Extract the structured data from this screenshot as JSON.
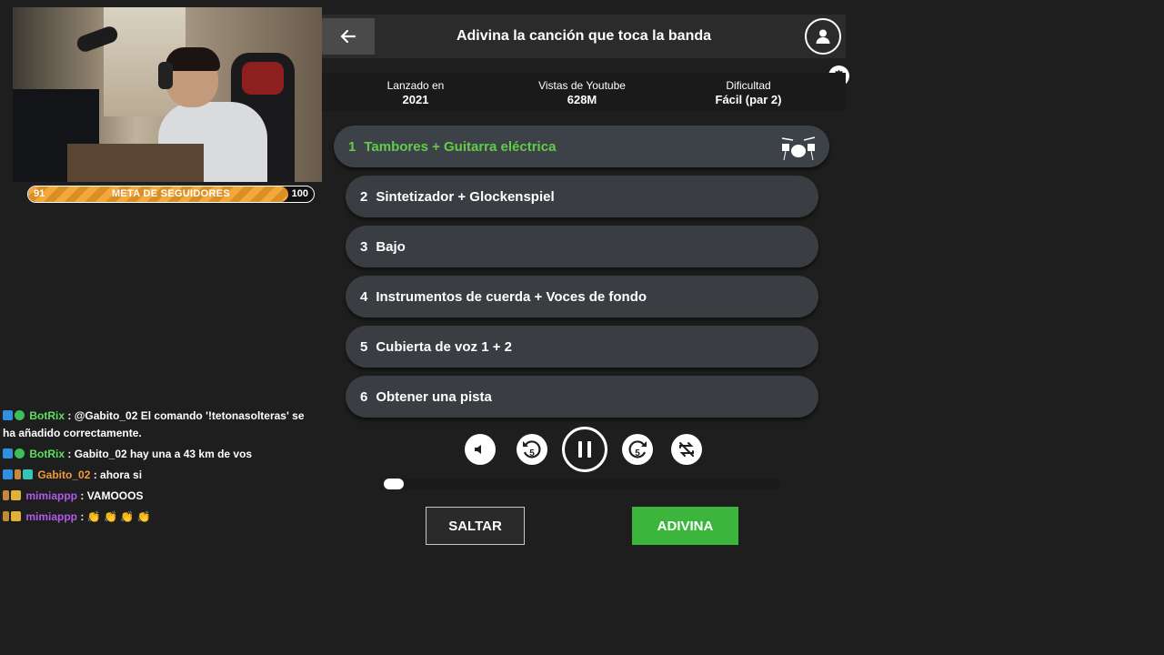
{
  "stream": {
    "goal": {
      "start": "91",
      "label": "META DE SEGUIDORES",
      "end": "100",
      "fraction": 0.91
    }
  },
  "chat": [
    {
      "user": "BotRix",
      "sep": " : ",
      "text": "@Gabito_02 El comando '!tetonasolteras' se ha añadido correctamente.",
      "user_color": "#5ee05e"
    },
    {
      "user": "BotRix",
      "sep": " : ",
      "text": "Gabito_02 hay una a 43 km de vos",
      "user_color": "#5ee05e"
    },
    {
      "user": "Gabito_02",
      "sep": " : ",
      "text": "ahora si",
      "user_color": "#f39a3c"
    },
    {
      "user": "mimiappp",
      "sep": " : ",
      "text": "VAMOOOS",
      "user_color": "#b15ae8"
    },
    {
      "user": "mimiappp",
      "sep": " : ",
      "text": "👏 👏 👏 👏",
      "user_color": "#b15ae8"
    }
  ],
  "game": {
    "title": "Adivina la canción que toca la banda",
    "back_icon": "arrow-left-icon",
    "profile_icon": "user-icon",
    "settings_icon": "gear-icon",
    "stats": [
      {
        "label": "Lanzado en",
        "value": "2021"
      },
      {
        "label": "Vistas de Youtube",
        "value": "628M"
      },
      {
        "label": "Dificultad",
        "value": "Fácil (par 2)"
      }
    ],
    "tracks": [
      {
        "num": "1",
        "label": "Tambores + Guitarra eléctrica",
        "active": true
      },
      {
        "num": "2",
        "label": "Sintetizador + Glockenspiel"
      },
      {
        "num": "3",
        "label": "Bajo"
      },
      {
        "num": "4",
        "label": "Instrumentos de cuerda + Voces de fondo"
      },
      {
        "num": "5",
        "label": "Cubierta de voz 1 + 2"
      },
      {
        "num": "6",
        "label": "Obtener una pista"
      }
    ],
    "controls": {
      "rewind_label": "5",
      "forward_label": "5",
      "progress_fraction": 0.05
    },
    "buttons": {
      "skip": "SALTAR",
      "guess": "ADIVINA"
    },
    "colors": {
      "accent_green": "#3bb53b",
      "active_track_text": "#62cc4a"
    }
  }
}
